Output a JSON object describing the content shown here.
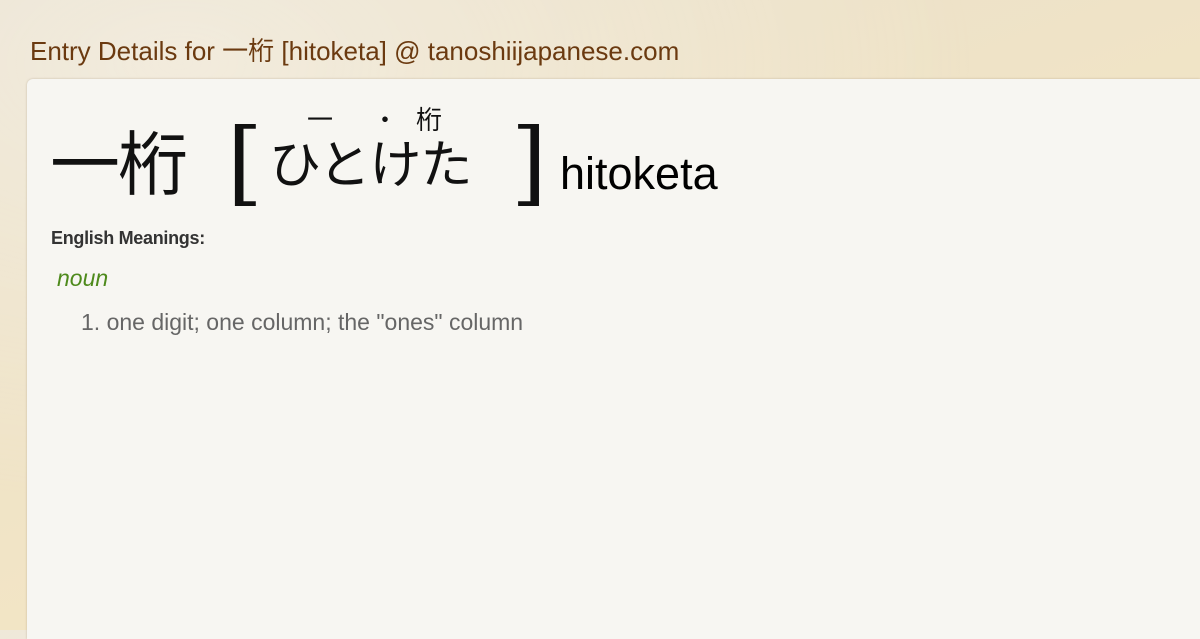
{
  "page": {
    "title": "Entry Details for 一桁 [hitoketa] @ tanoshiijapanese.com"
  },
  "entry": {
    "headword": "一桁",
    "bracket_open": "[",
    "bracket_close": "]",
    "furigana_top": [
      "一",
      "・",
      "桁"
    ],
    "kana": "ひとけた",
    "romaji": "hitoketa"
  },
  "meanings": {
    "heading": "English Meanings:",
    "part_of_speech": "noun",
    "items": [
      "1. one digit; one column; the \"ones\" column"
    ]
  }
}
